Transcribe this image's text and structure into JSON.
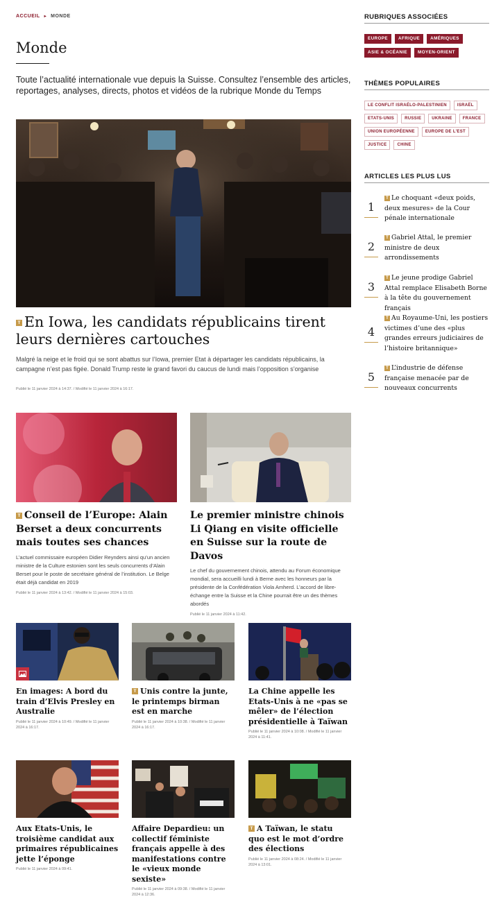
{
  "breadcrumb": {
    "home": "ACCUEIL",
    "current": "MONDE"
  },
  "page": {
    "title": "Monde",
    "intro": "Toute l’actualité internationale vue depuis la Suisse. Consultez l’ensemble des articles, reportages, analyses, directs, photos et vidéos de la rubrique Monde du Temps"
  },
  "hero": {
    "badge": "T",
    "title": "En Iowa, les candidats républicains tirent leurs dernières cartouches",
    "description": "Malgré la neige et le froid qui se sont abattus sur l’Iowa, premier Etat à départager les candidats républicains, la campagne n’est pas figée. Donald Trump reste le grand favori du caucus de lundi mais l’opposition s’organise",
    "meta": "Publié le 11 janvier 2024 à 14:37. / Modifié le 11 janvier 2024 à 16:17."
  },
  "row2": [
    {
      "badge": "T",
      "title": "Conseil de l’Europe: Alain Berset a deux concurrents mais toutes ses chances",
      "description": "L’actuel commissaire européen Didier Reynders ainsi qu’un ancien ministre de la Culture estonien sont les seuls concurrents d’Alain Berset pour le poste de secrétaire général de l’institution. Le Belge était déjà candidat en 2019",
      "meta": "Publié le 11 janvier 2024 à 13:42. / Modifié le 11 janvier 2024 à 15:03."
    },
    {
      "badge": "",
      "title": "Le premier ministre chinois Li Qiang en visite officielle en Suisse sur la route de Davos",
      "description": "Le chef du gouvernement chinois, attendu au Forum économique mondial, sera accueilli lundi à Berne avec les honneurs par la présidente de la Confédération Viola Amherd. L’accord de libre-échange entre la Suisse et la Chine pourrait être un des thèmes abordés",
      "meta": "Publié le 11 janvier 2024 à 11:42."
    }
  ],
  "row3": [
    {
      "badge": "",
      "title": "En images: A bord du train d’Elvis Presley en Australie",
      "meta": "Publié le 11 janvier 2024 à 10:49. / Modifié le 11 janvier 2024 à 16:17."
    },
    {
      "badge": "T",
      "title": "Unis contre la junte, le printemps birman est en marche",
      "meta": "Publié le 11 janvier 2024 à 10:38. / Modifié le 11 janvier 2024 à 16:17."
    },
    {
      "badge": "",
      "title": "La Chine appelle les Etats-Unis à ne «pas se mêler» de l’élection présidentielle à Taïwan",
      "meta": "Publié le 11 janvier 2024 à 10:08. / Modifié le 11 janvier 2024 à 11:41."
    }
  ],
  "row4": [
    {
      "badge": "",
      "title": "Aux Etats-Unis, le troisième candidat aux primaires républicaines jette l’éponge",
      "meta": "Publié le 11 janvier 2024 à 09:41."
    },
    {
      "badge": "",
      "title": "Affaire Depardieu: un collectif féministe français appelle à des manifestations contre le «vieux monde sexiste»",
      "meta": "Publié le 11 janvier 2024 à 09:38. / Modifié le 11 janvier 2024 à 12:36."
    },
    {
      "badge": "T",
      "title": "A Taïwan, le statu quo est le mot d’ordre des élections",
      "meta": "Publié le 11 janvier 2024 à 08:24. / Modifié le 11 janvier 2024 à 13:01."
    }
  ],
  "sidebar": {
    "rubriques_title": "RUBRIQUES ASSOCIÉES",
    "rubriques": [
      "EUROPE",
      "AFRIQUE",
      "AMÉRIQUES",
      "ASIE & OCÉANIE",
      "MOYEN-ORIENT"
    ],
    "themes_title": "THÈMES POPULAIRES",
    "themes": [
      "LE CONFLIT ISRAÉLO-PALESTINIEN",
      "ISRAËL",
      "ETATS-UNIS",
      "RUSSIE",
      "UKRAINE",
      "FRANCE",
      "UNION EUROPÉENNE",
      "EUROPE DE L’EST",
      "JUSTICE",
      "CHINE"
    ],
    "popular_title": "ARTICLES LES PLUS LUS",
    "popular": [
      {
        "rank": "1",
        "badge": "T",
        "title": "Le choquant «deux poids, deux mesures» de la Cour pénale internationale"
      },
      {
        "rank": "2",
        "badge": "T",
        "title": "Gabriel Attal, le premier ministre de deux arrondissements"
      },
      {
        "rank": "3",
        "badge": "T",
        "title": "Le jeune prodige Gabriel Attal remplace Elisabeth Borne à la tête du gouvernement français"
      },
      {
        "rank": "4",
        "badge": "T",
        "title": "Au Royaume-Uni, les postiers victimes d’une des «plus grandes erreurs judiciaires de l’histoire britannique»"
      },
      {
        "rank": "5",
        "badge": "T",
        "title": "L’industrie de défense française menacée par de nouveaux concurrents"
      }
    ]
  },
  "colors": {
    "accent": "#8b1a2b",
    "badge_gold": "#c69a4a",
    "image_icon_red": "#c8313f"
  },
  "icons": {
    "premium_badge": "T-badge-icon",
    "gallery": "image-gallery-icon"
  }
}
